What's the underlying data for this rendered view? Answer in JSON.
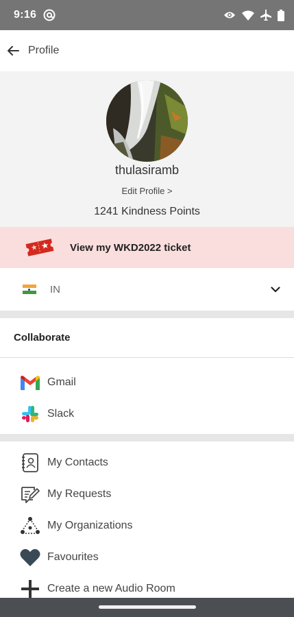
{
  "status_bar": {
    "time": "9:16",
    "icons": [
      "at-sign-icon",
      "eye-icon",
      "wifi-icon",
      "airplane-icon",
      "battery-icon"
    ]
  },
  "app_bar": {
    "title": "Profile",
    "back_icon": "arrow-left-icon"
  },
  "profile": {
    "username": "thulasiramb",
    "edit_label": "Edit Profile >",
    "points_label": "1241 Kindness Points",
    "avatar": "waterfall-photo"
  },
  "ticket": {
    "label": "View my WKD2022 ticket",
    "icon": "ticket-icon",
    "background": "#fadddd"
  },
  "country": {
    "code": "IN",
    "flag": "india-flag-icon",
    "chevron": "chevron-down-icon"
  },
  "collaborate": {
    "header": "Collaborate",
    "items": [
      {
        "label": "Gmail",
        "icon": "gmail-icon"
      },
      {
        "label": "Slack",
        "icon": "slack-icon"
      }
    ]
  },
  "menu": {
    "items": [
      {
        "label": "My Contacts",
        "icon": "contacts-book-icon"
      },
      {
        "label": "My Requests",
        "icon": "requests-edit-icon"
      },
      {
        "label": "My Organizations",
        "icon": "organization-icon"
      },
      {
        "label": "Favourites",
        "icon": "heart-icon"
      },
      {
        "label": "Create a new Audio Room",
        "icon": "plus-icon"
      }
    ]
  },
  "colors": {
    "status_bar": "#757575",
    "profile_bg": "#f3f3f3",
    "nav_bar": "#4b4f54"
  }
}
